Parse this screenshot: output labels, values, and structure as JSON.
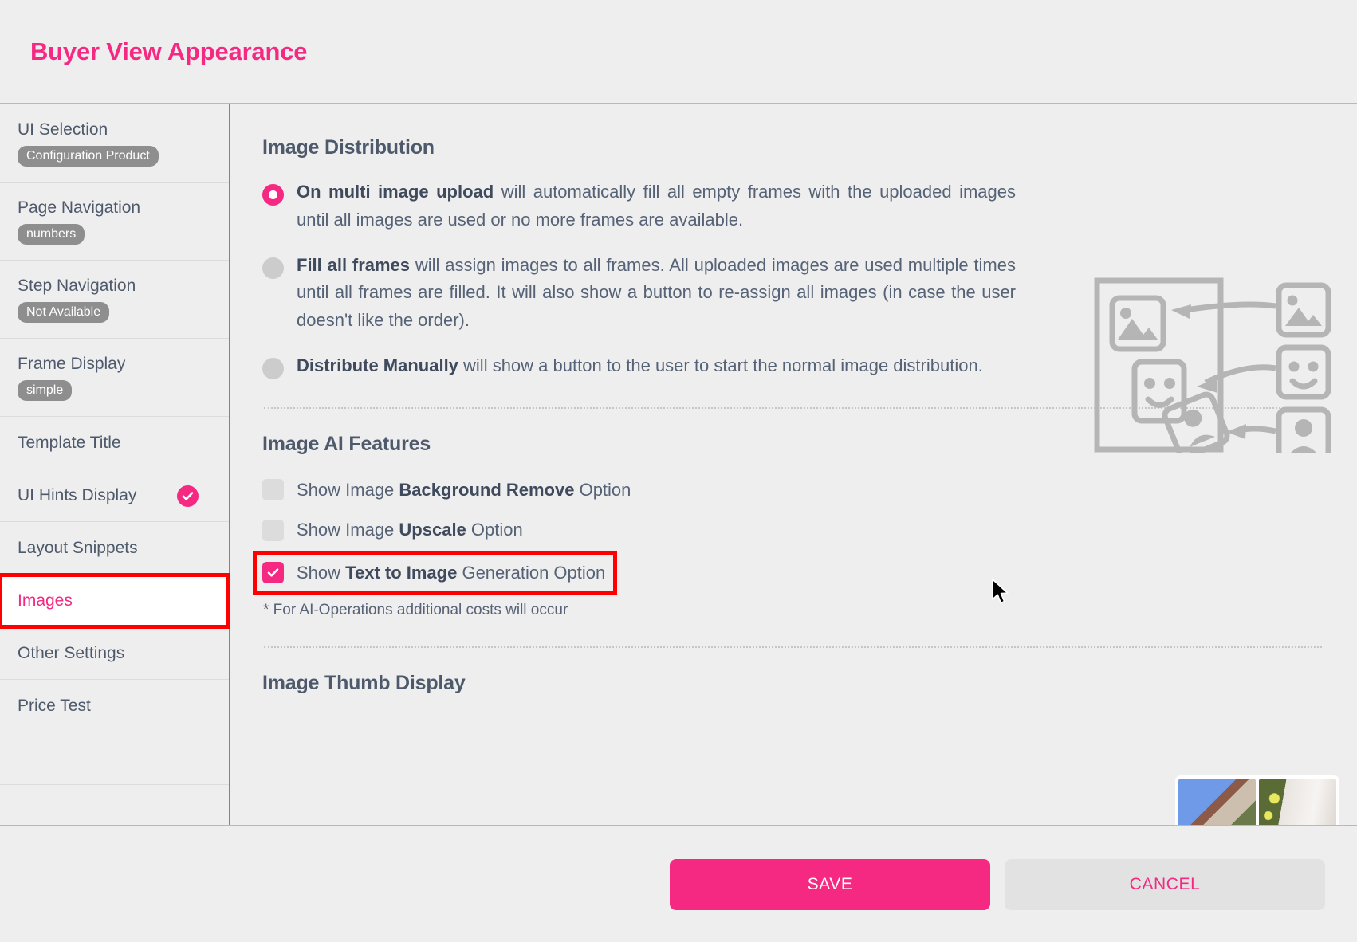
{
  "header": {
    "title": "Buyer View Appearance"
  },
  "sidebar": {
    "items": [
      {
        "label": "UI Selection",
        "badge": "Configuration Product"
      },
      {
        "label": "Page Navigation",
        "badge": "numbers"
      },
      {
        "label": "Step Navigation",
        "badge": "Not Available"
      },
      {
        "label": "Frame Display",
        "badge": "simple"
      },
      {
        "label": "Template Title",
        "badge": null
      },
      {
        "label": "UI Hints Display",
        "badge": null,
        "check": true
      },
      {
        "label": "Layout Snippets",
        "badge": null
      },
      {
        "label": "Images",
        "badge": null,
        "active": true
      },
      {
        "label": "Other Settings",
        "badge": null
      },
      {
        "label": "Price Test",
        "badge": null
      }
    ]
  },
  "main": {
    "distribution": {
      "title": "Image Distribution",
      "options": [
        {
          "selected": true,
          "strong": "On multi image upload",
          "rest": " will automatically fill all empty frames with the uploaded images until all images are used or no more frames are available."
        },
        {
          "selected": false,
          "strong": "Fill all frames",
          "rest": " will assign images to all frames. All uploaded images are used multiple times until all frames are filled. It will also show a button to re-assign all images (in case the user doesn't like the order)."
        },
        {
          "selected": false,
          "strong": "Distribute Manually",
          "rest": " will show a button to the user to start the normal image distribution."
        }
      ]
    },
    "ai_features": {
      "title": "Image AI Features",
      "options": [
        {
          "checked": false,
          "pre": "Show Image ",
          "strong": "Background Remove",
          "post": " Option"
        },
        {
          "checked": false,
          "pre": "Show Image ",
          "strong": "Upscale",
          "post": " Option"
        },
        {
          "checked": true,
          "pre": "Show ",
          "strong": "Text to Image",
          "post": " Generation Option",
          "highlighted": true
        }
      ],
      "footnote": "* For AI-Operations additional costs will occur"
    },
    "thumb_display": {
      "title": "Image Thumb Display"
    }
  },
  "footer": {
    "save_label": "SAVE",
    "cancel_label": "CANCEL"
  },
  "colors": {
    "accent": "#f52882",
    "highlight": "#fe0000",
    "text": "#566276",
    "badge": "#8e8e8e",
    "background": "#eeeeee"
  }
}
